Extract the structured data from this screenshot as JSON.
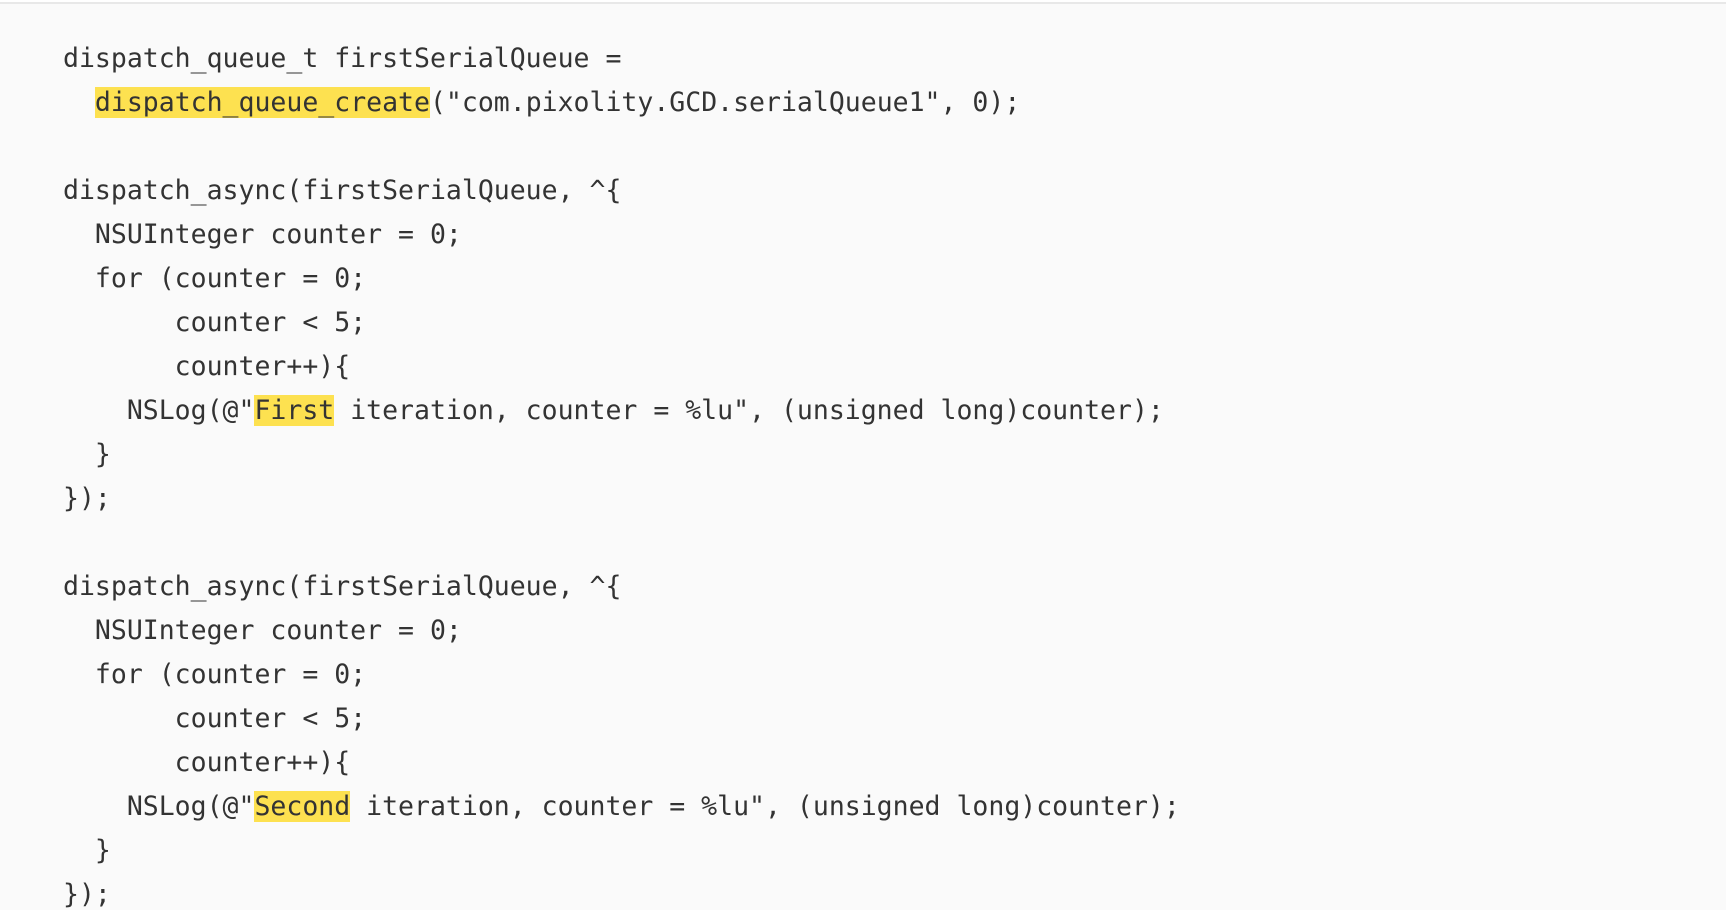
{
  "colors": {
    "panel_background": "#fafafa",
    "text": "#333333",
    "highlight": "#fde150"
  },
  "code_lines": [
    {
      "parts": [
        {
          "text": "dispatch_queue_t firstSerialQueue ="
        }
      ]
    },
    {
      "parts": [
        {
          "text": "  "
        },
        {
          "text": "dispatch_queue_create",
          "highlight": true
        },
        {
          "text": "(\"com.pixolity.GCD.serialQueue1\", 0);"
        }
      ]
    },
    {
      "parts": [
        {
          "text": ""
        }
      ]
    },
    {
      "parts": [
        {
          "text": "dispatch_async(firstSerialQueue, ^{"
        }
      ]
    },
    {
      "parts": [
        {
          "text": "  NSUInteger counter = 0;"
        }
      ]
    },
    {
      "parts": [
        {
          "text": "  for (counter = 0;"
        }
      ]
    },
    {
      "parts": [
        {
          "text": "       counter < 5;"
        }
      ]
    },
    {
      "parts": [
        {
          "text": "       counter++){"
        }
      ]
    },
    {
      "parts": [
        {
          "text": "    NSLog(@\""
        },
        {
          "text": "First",
          "highlight": true
        },
        {
          "text": " iteration, counter = %lu\", (unsigned long)counter);"
        }
      ]
    },
    {
      "parts": [
        {
          "text": "  }"
        }
      ]
    },
    {
      "parts": [
        {
          "text": "});"
        }
      ]
    },
    {
      "parts": [
        {
          "text": ""
        }
      ]
    },
    {
      "parts": [
        {
          "text": "dispatch_async(firstSerialQueue, ^{"
        }
      ]
    },
    {
      "parts": [
        {
          "text": "  NSUInteger counter = 0;"
        }
      ]
    },
    {
      "parts": [
        {
          "text": "  for (counter = 0;"
        }
      ]
    },
    {
      "parts": [
        {
          "text": "       counter < 5;"
        }
      ]
    },
    {
      "parts": [
        {
          "text": "       counter++){"
        }
      ]
    },
    {
      "parts": [
        {
          "text": "    NSLog(@\""
        },
        {
          "text": "Second",
          "highlight": true
        },
        {
          "text": " iteration, counter = %lu\", (unsigned long)counter);"
        }
      ]
    },
    {
      "parts": [
        {
          "text": "  }"
        }
      ]
    },
    {
      "parts": [
        {
          "text": "});"
        }
      ]
    }
  ]
}
